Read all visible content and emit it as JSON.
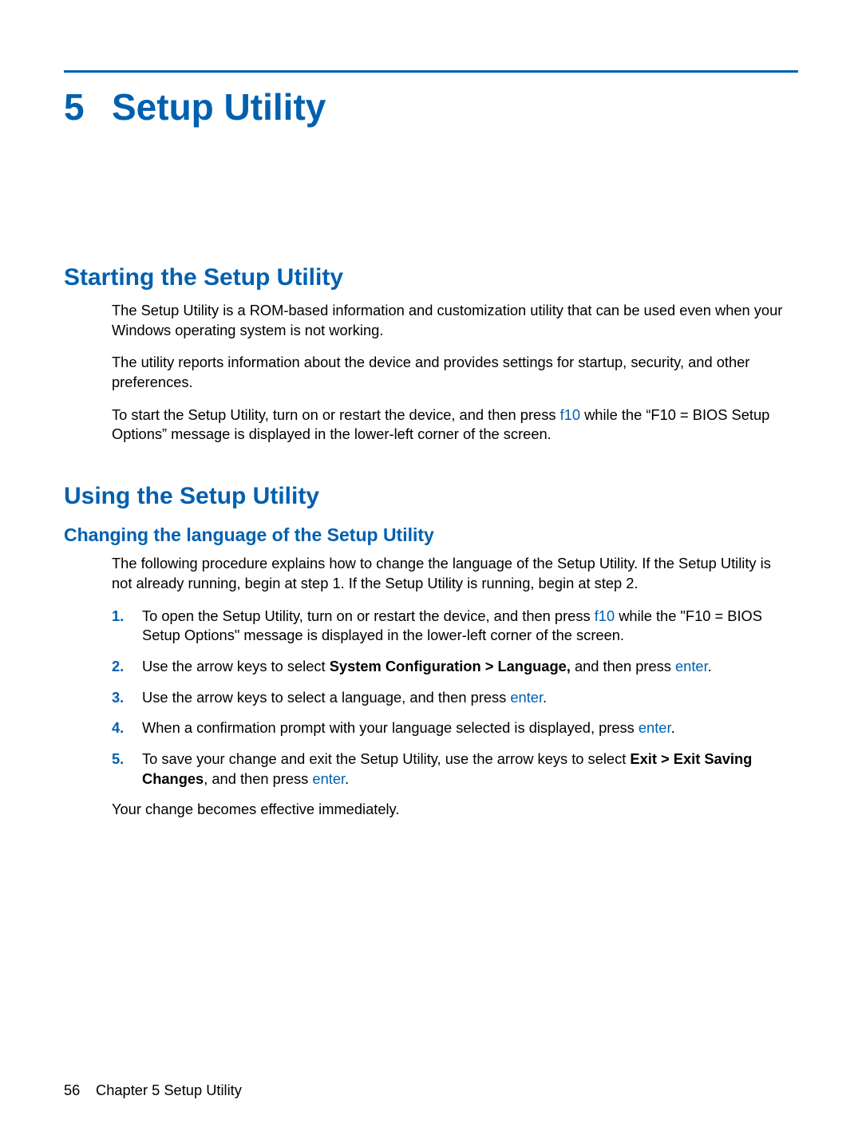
{
  "chapter": {
    "number": "5",
    "title": "Setup Utility"
  },
  "section1": {
    "heading": "Starting the Setup Utility",
    "p1": "The Setup Utility is a ROM-based information and customization utility that can be used even when your Windows operating system is not working.",
    "p2": "The utility reports information about the device and provides settings for startup, security, and other preferences.",
    "p3_a": "To start the Setup Utility, turn on or restart the device, and then press ",
    "p3_key": "f10",
    "p3_b": " while the “F10 = BIOS Setup Options” message is displayed in the lower-left corner of the screen."
  },
  "section2": {
    "heading": "Using the Setup Utility",
    "sub1": {
      "heading": "Changing the language of the Setup Utility",
      "intro": "The following procedure explains how to change the language of the Setup Utility. If the Setup Utility is not already running, begin at step 1. If the Setup Utility is running, begin at step 2.",
      "steps": {
        "s1_a": "To open the Setup Utility, turn on or restart the device, and then press ",
        "s1_key": "f10",
        "s1_b": " while the \"F10 = BIOS Setup Options\" message is displayed in the lower-left corner of the screen.",
        "s2_a": "Use the arrow keys to select ",
        "s2_bold": "System Configuration > Language,",
        "s2_b": "  and then press ",
        "s2_key": "enter",
        "s2_c": ".",
        "s3_a": "Use the arrow keys to select a language, and then press ",
        "s3_key": "enter",
        "s3_b": ".",
        "s4_a": "When a confirmation prompt with your language selected is displayed, press ",
        "s4_key": "enter",
        "s4_b": ".",
        "s5_a": "To save your change and exit the Setup Utility, use the arrow keys to select ",
        "s5_bold": "Exit > Exit Saving Changes",
        "s5_b": ", and then press ",
        "s5_key": "enter",
        "s5_c": "."
      },
      "outro": "Your change becomes effective immediately."
    }
  },
  "nums": {
    "n1": "1.",
    "n2": "2.",
    "n3": "3.",
    "n4": "4.",
    "n5": "5."
  },
  "footer": {
    "page": "56",
    "label": "Chapter 5   Setup Utility"
  }
}
